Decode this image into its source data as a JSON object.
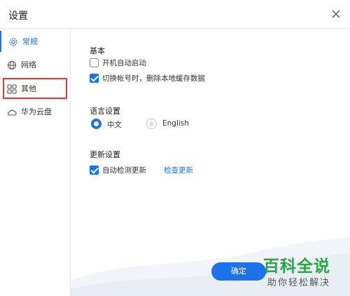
{
  "window": {
    "title": "设置"
  },
  "sidebar": {
    "items": [
      {
        "label": "常规",
        "icon": "gear-icon",
        "active": true
      },
      {
        "label": "网络",
        "icon": "globe-icon"
      },
      {
        "label": "其他",
        "icon": "grid-icon",
        "highlighted": true
      },
      {
        "label": "华为云盘",
        "icon": "cloud-icon"
      }
    ]
  },
  "basic": {
    "title": "基本",
    "autostart_label": "开机自动启动",
    "autostart_checked": false,
    "clear_cache_label": "切换帐号时，删除本地缓存数据",
    "clear_cache_checked": true
  },
  "language": {
    "title": "语言设置",
    "options": [
      {
        "label": "中文",
        "selected": true
      },
      {
        "label": "English",
        "selected": false
      }
    ]
  },
  "update": {
    "title": "更新设置",
    "auto_check_label": "自动检测更新",
    "auto_check_checked": true,
    "check_link": "检查更新"
  },
  "footer": {
    "ok_label": "确定"
  },
  "watermark": {
    "main": "百科全说",
    "sub": "助你轻松解决"
  },
  "colors": {
    "accent": "#1a73e8",
    "highlight_box": "#e53935",
    "watermark_green": "#2aa845"
  }
}
